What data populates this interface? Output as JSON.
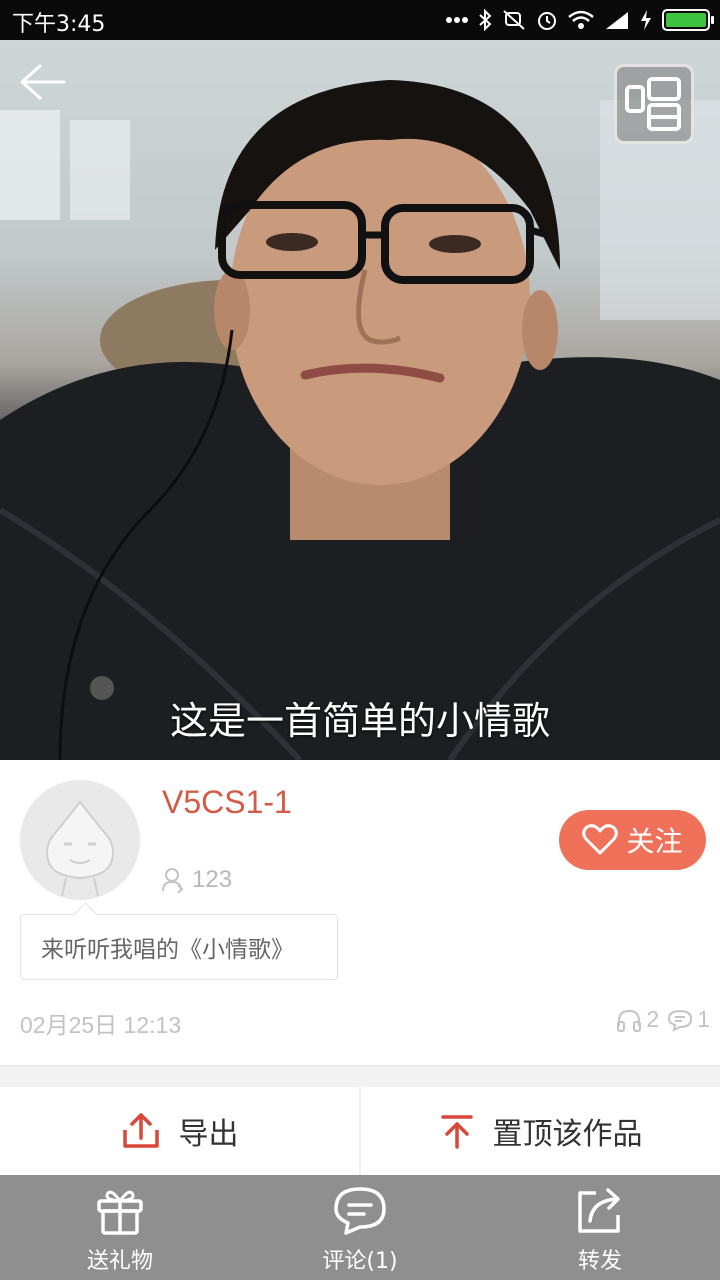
{
  "status_bar": {
    "time": "下午3:45",
    "icons": [
      "more-dots-icon",
      "bluetooth-icon",
      "mute-icon",
      "alarm-icon",
      "wifi-icon",
      "signal-icon",
      "charging-icon",
      "battery-icon"
    ]
  },
  "video": {
    "subtitle": "这是一首简单的小情歌"
  },
  "profile": {
    "username": "V5CS1-1",
    "fans_count": "123",
    "follow_label": "关注",
    "description": "来听听我唱的《小情歌》",
    "post_time": "02月25日 12:13",
    "listen_count": "2",
    "comment_count": "1"
  },
  "actions": {
    "export_label": "导出",
    "pin_label": "置顶该作品"
  },
  "bottom_tabs": [
    {
      "label": "送礼物",
      "icon": "gift-icon"
    },
    {
      "label": "评论(1)",
      "icon": "comment-icon"
    },
    {
      "label": "转发",
      "icon": "share-icon"
    }
  ],
  "colors": {
    "accent": "#f07159",
    "username": "#d35a45",
    "bottom_bar": "#8f8f8f"
  }
}
